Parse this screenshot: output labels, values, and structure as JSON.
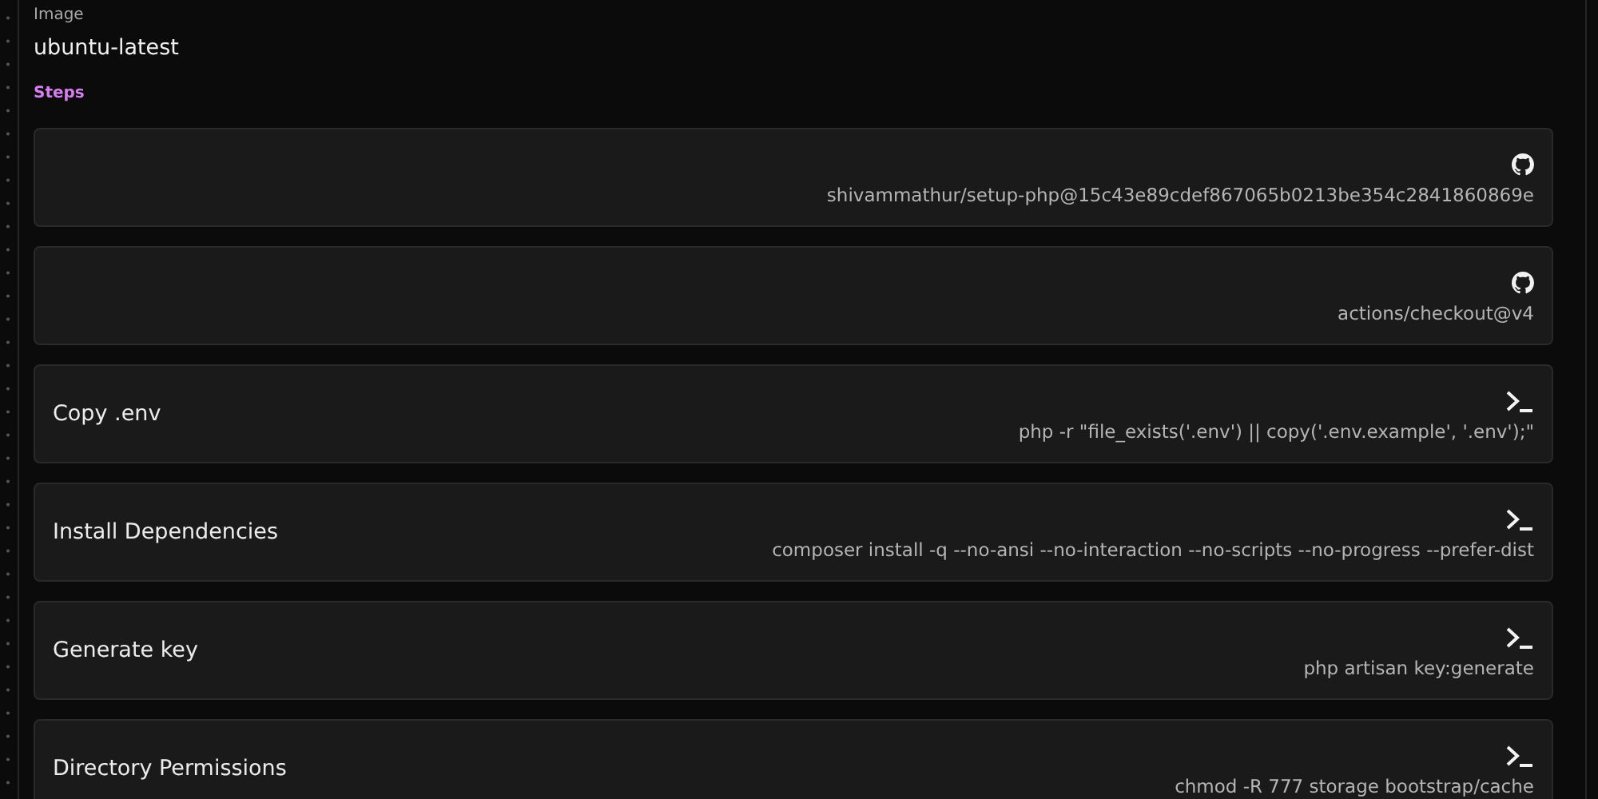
{
  "image": {
    "label": "Image",
    "value": "ubuntu-latest"
  },
  "steps_heading": "Steps",
  "steps": [
    {
      "kind": "uses",
      "detail": "shivammathur/setup-php@15c43e89cdef867065b0213be354c2841860869e"
    },
    {
      "kind": "uses",
      "detail": "actions/checkout@v4"
    },
    {
      "kind": "run",
      "name": "Copy .env",
      "detail": "php -r \"file_exists('.env') || copy('.env.example', '.env');\""
    },
    {
      "kind": "run",
      "name": "Install Dependencies",
      "detail": "composer install -q --no-ansi --no-interaction --no-scripts --no-progress --prefer-dist"
    },
    {
      "kind": "run",
      "name": "Generate key",
      "detail": "php artisan key:generate"
    },
    {
      "kind": "run",
      "name": "Directory Permissions",
      "detail": "chmod -R 777 storage bootstrap/cache"
    }
  ]
}
